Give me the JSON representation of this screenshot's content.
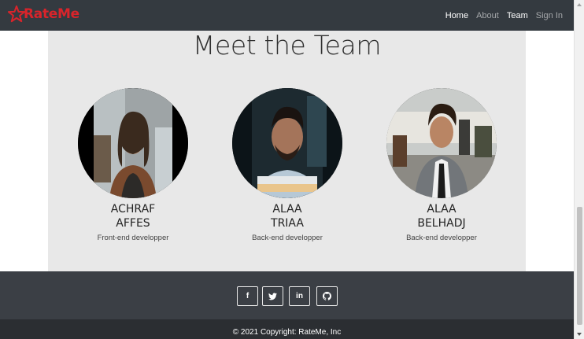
{
  "brand": {
    "name": "RateMe",
    "color": "#d9242b"
  },
  "nav": {
    "items": [
      {
        "label": "Home",
        "active": true
      },
      {
        "label": "About",
        "active": false
      },
      {
        "label": "Team",
        "active": true
      },
      {
        "label": "Sign In",
        "active": false
      }
    ]
  },
  "team": {
    "title": "Meet the Team",
    "members": [
      {
        "first": "ACHRAF",
        "last": "AFFES",
        "role": "Front-end developper"
      },
      {
        "first": "ALAA",
        "last": "TRIAA",
        "role": "Back-end developper"
      },
      {
        "first": "ALAA",
        "last": "BELHADJ",
        "role": "Back-end developper"
      }
    ]
  },
  "footer": {
    "social": [
      {
        "icon": "facebook-icon",
        "glyph": "f"
      },
      {
        "icon": "twitter-icon",
        "glyph": ""
      },
      {
        "icon": "linkedin-icon",
        "glyph": "in"
      },
      {
        "icon": "github-icon",
        "glyph": ""
      }
    ],
    "copyright": "© 2021 Copyright: RateMe, Inc"
  }
}
